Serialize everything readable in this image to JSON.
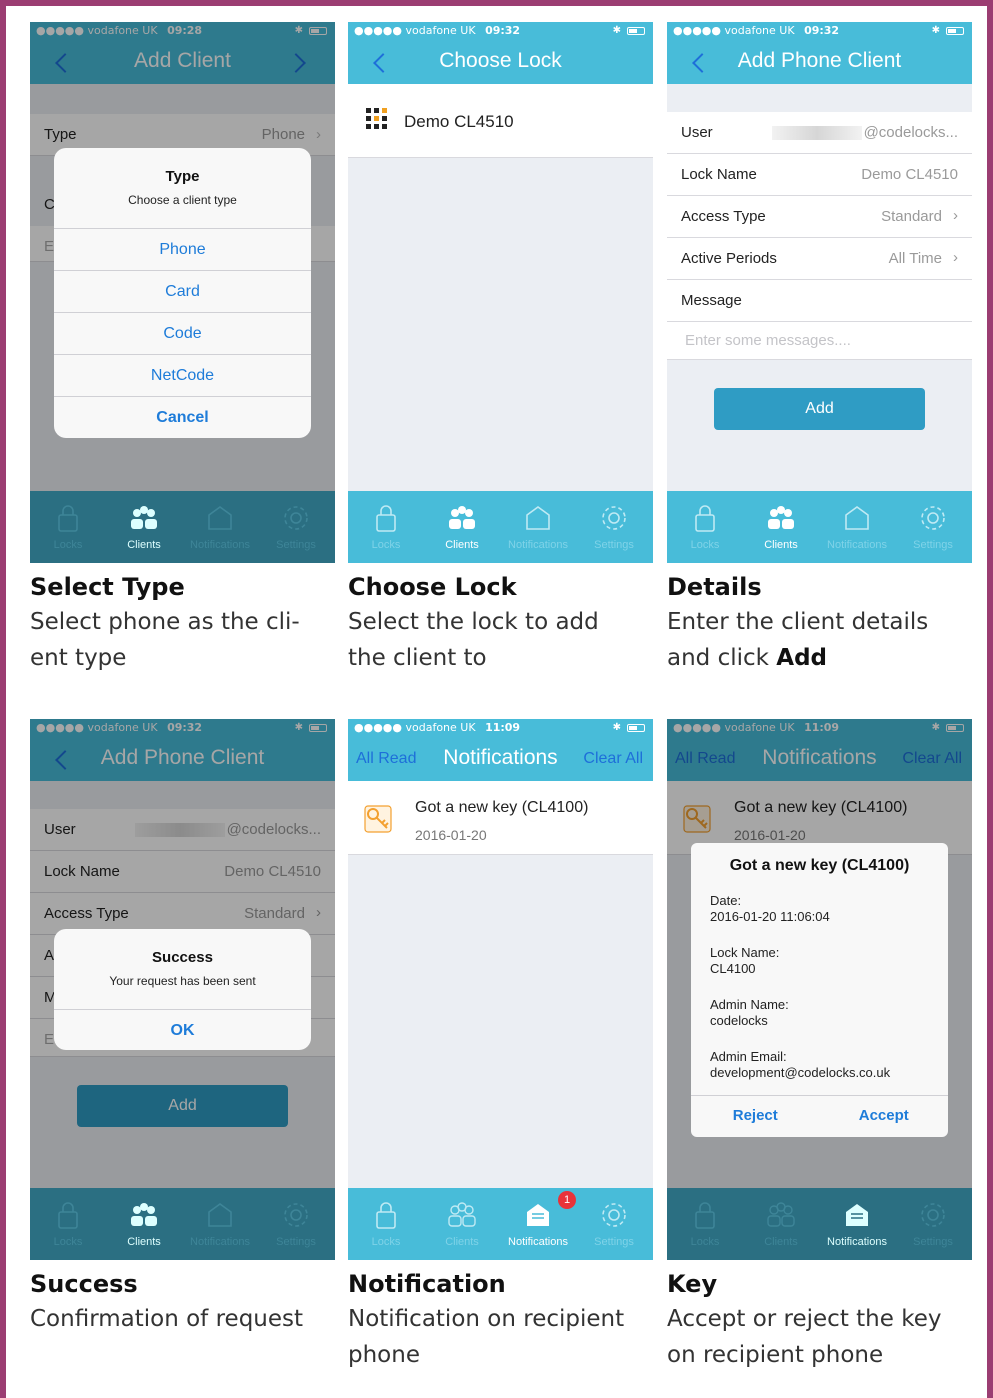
{
  "colors": {
    "accent": "#48bcd9",
    "border": "#9b3d72",
    "link": "#1e7cd9",
    "button": "#2f9cc4"
  },
  "panels": [
    {
      "status": {
        "carrier": "●●●●● vodafone UK ",
        "time": "09:28"
      },
      "nav": {
        "title": "Add Client"
      },
      "rows": [
        {
          "label": "Type",
          "value": "Phone"
        }
      ],
      "partial_labels": [
        "C",
        "E"
      ],
      "sheet": {
        "title": "Type",
        "subtitle": "Choose a client type",
        "options": [
          "Phone",
          "Card",
          "Code",
          "NetCode"
        ],
        "cancel": "Cancel"
      },
      "caption": {
        "title": "Select Type",
        "desc": "Select phone as the cli-\nent type"
      }
    },
    {
      "status": {
        "carrier": "●●●●● vodafone UK ",
        "time": "09:32"
      },
      "nav": {
        "title": "Choose Lock"
      },
      "lock_item": {
        "name": "Demo CL4510",
        "icon": "codelocks-logo-icon"
      },
      "caption": {
        "title": "Choose Lock",
        "desc": "Select the lock to add\nthe client to"
      }
    },
    {
      "status": {
        "carrier": "●●●●● vodafone UK ",
        "time": "09:32"
      },
      "nav": {
        "title": "Add Phone Client"
      },
      "rows": [
        {
          "label": "User",
          "value": "@codelocks..."
        },
        {
          "label": "Lock Name",
          "value": "Demo CL4510"
        },
        {
          "label": "Access Type",
          "value": "Standard"
        },
        {
          "label": "Active Periods",
          "value": "All Time"
        },
        {
          "label": "Message",
          "value": ""
        }
      ],
      "message_placeholder": "Enter some messages....",
      "add_button": "Add",
      "caption": {
        "title": "Details",
        "desc_prefix": "Enter the client details\nand click ",
        "desc_bold": "Add"
      }
    },
    {
      "status": {
        "carrier": "●●●●● vodafone UK ",
        "time": "09:32"
      },
      "nav": {
        "title": "Add Phone Client"
      },
      "rows": [
        {
          "label": "User",
          "value": "@codelocks..."
        },
        {
          "label": "Lock Name",
          "value": "Demo CL4510"
        },
        {
          "label": "Access Type",
          "value": "Standard"
        }
      ],
      "partial_labels": [
        "A",
        "M",
        "E"
      ],
      "add_button": "Add",
      "alert": {
        "title": "Success",
        "message": "Your request has been sent",
        "ok": "OK"
      },
      "caption": {
        "title": "Success",
        "desc": "Confirmation of request"
      }
    },
    {
      "status": {
        "carrier": "●●●●● vodafone UK ",
        "time": "11:09"
      },
      "nav": {
        "left": "All Read",
        "title": "Notifications",
        "right": "Clear All"
      },
      "notification": {
        "title": "Got a new key (CL4100)",
        "date": "2016-01-20"
      },
      "badge": "1",
      "caption": {
        "title": "Notification",
        "desc": "Notification on recipient\nphone"
      }
    },
    {
      "status": {
        "carrier": "●●●●● vodafone UK ",
        "time": "11:09"
      },
      "nav": {
        "left": "All Read",
        "title": "Notifications",
        "right": "Clear All"
      },
      "notification": {
        "title": "Got a new key (CL4100)",
        "date": "2016-01-20"
      },
      "dialog": {
        "title": "Got a new key (CL4100)",
        "fields": [
          {
            "label": "Date:",
            "value": "2016-01-20 11:06:04"
          },
          {
            "label": "Lock Name:",
            "value": "CL4100"
          },
          {
            "label": "Admin Name:",
            "value": "codelocks"
          },
          {
            "label": "Admin Email:",
            "value": "development@codelocks.co.uk"
          }
        ],
        "reject": "Reject",
        "accept": "Accept"
      },
      "caption": {
        "title": "Key",
        "desc": "Accept or reject the key\non recipient phone"
      }
    }
  ],
  "tabs": [
    "Locks",
    "Clients",
    "Notifications",
    "Settings"
  ]
}
